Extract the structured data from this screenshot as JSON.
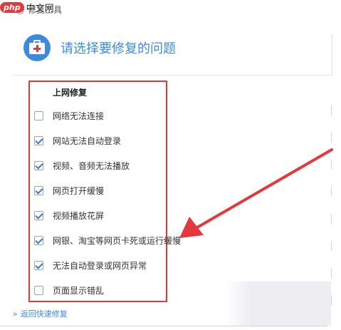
{
  "watermark": {
    "badge": "php",
    "text": "中文网"
  },
  "window": {
    "title": "修复工具"
  },
  "header": {
    "title": "请选择要修复的问题"
  },
  "section": {
    "title": "上网修复"
  },
  "items": [
    {
      "label": "网络无法连接",
      "checked": false
    },
    {
      "label": "网站无法自动登录",
      "checked": true
    },
    {
      "label": "视频、音频无法播放",
      "checked": true
    },
    {
      "label": "网页打开缓慢",
      "checked": true
    },
    {
      "label": "视频播放花屏",
      "checked": true
    },
    {
      "label": "网银、淘宝等网页卡死或运行缓慢",
      "checked": true
    },
    {
      "label": "无法自动登录或网页异常",
      "checked": true
    },
    {
      "label": "页面显示错乱",
      "checked": false
    }
  ],
  "footer": {
    "back_label": "返回快速修复",
    "back_icon": "double-chevron-right-icon"
  },
  "colors": {
    "accent": "#3c8ae0",
    "highlight": "#e4393c"
  }
}
